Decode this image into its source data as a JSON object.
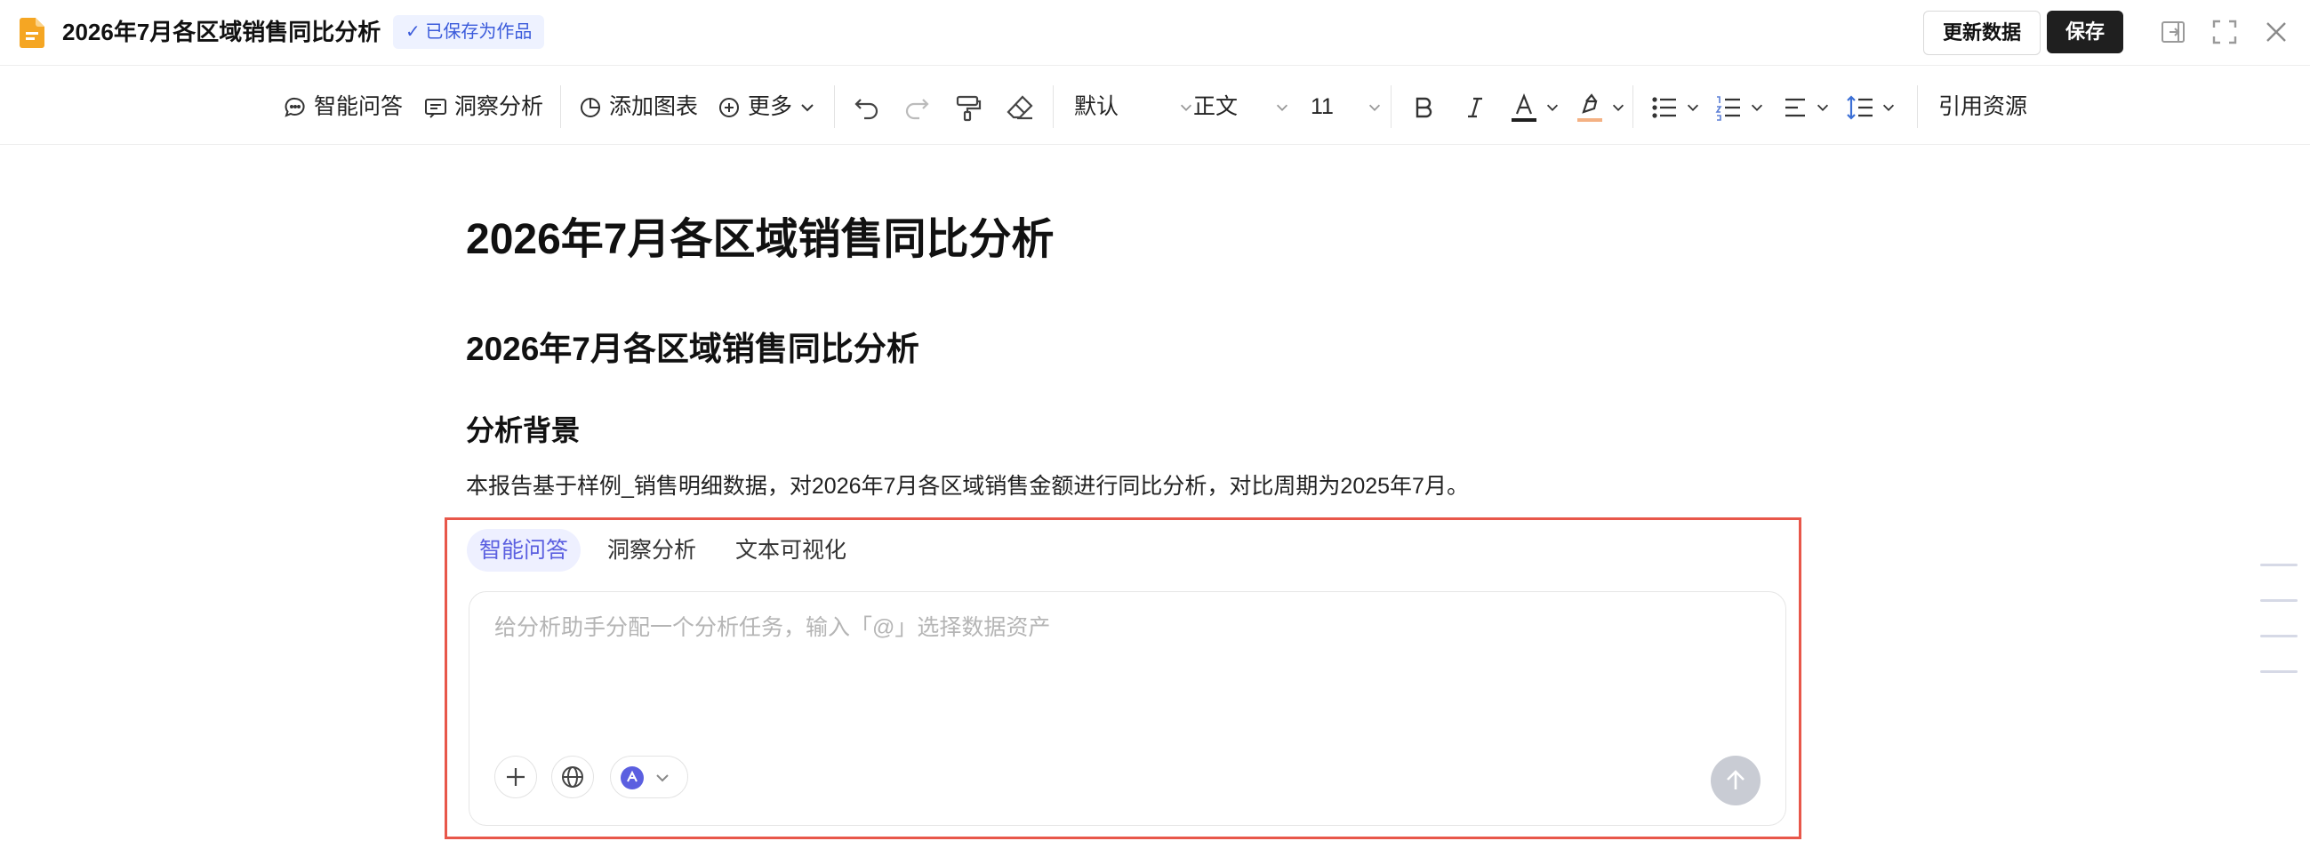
{
  "header": {
    "title": "2026年7月各区域销售同比分析",
    "saved_badge": "✓ 已保存为作品",
    "update_button": "更新数据",
    "save_button": "保存",
    "icons": [
      "doc-file-icon",
      "exit-panel-icon",
      "fullscreen-icon",
      "close-icon"
    ]
  },
  "toolbar": {
    "smart_qa": "智能问答",
    "insight": "洞察分析",
    "add_chart": "添加图表",
    "more": "更多",
    "font_family": "默认",
    "paragraph_style": "正文",
    "font_size": "11",
    "cite_resources": "引用资源",
    "icons": [
      "undo-icon",
      "redo-icon",
      "format-painter-icon",
      "eraser-icon",
      "bold-icon",
      "italic-icon",
      "text-color-icon",
      "highlight-icon",
      "bullet-list-icon",
      "numbered-list-icon",
      "align-icon",
      "line-spacing-icon"
    ],
    "colors": {
      "text_color_bar": "#1f1f1f",
      "highlight_bar": "#f4b183"
    }
  },
  "document": {
    "h1": "2026年7月各区域销售同比分析",
    "h2": "2026年7月各区域销售同比分析",
    "h3": "分析背景",
    "paragraph": "本报告基于样例_销售明细数据，对2026年7月各区域销售金额进行同比分析，对比周期为2025年7月。"
  },
  "ai_panel": {
    "tabs": [
      {
        "label": "智能问答",
        "active": true
      },
      {
        "label": "洞察分析",
        "active": false
      },
      {
        "label": "文本可视化",
        "active": false
      }
    ],
    "input_placeholder": "给分析助手分配一个分析任务，输入「@」选择数据资产",
    "buttons": [
      "add-icon",
      "globe-icon",
      "model-logo-icon",
      "send-arrow-icon"
    ],
    "colors": {
      "border": "#e8574a",
      "accent": "#5b5fe0",
      "send_disabled": "#c9ccd4"
    }
  }
}
